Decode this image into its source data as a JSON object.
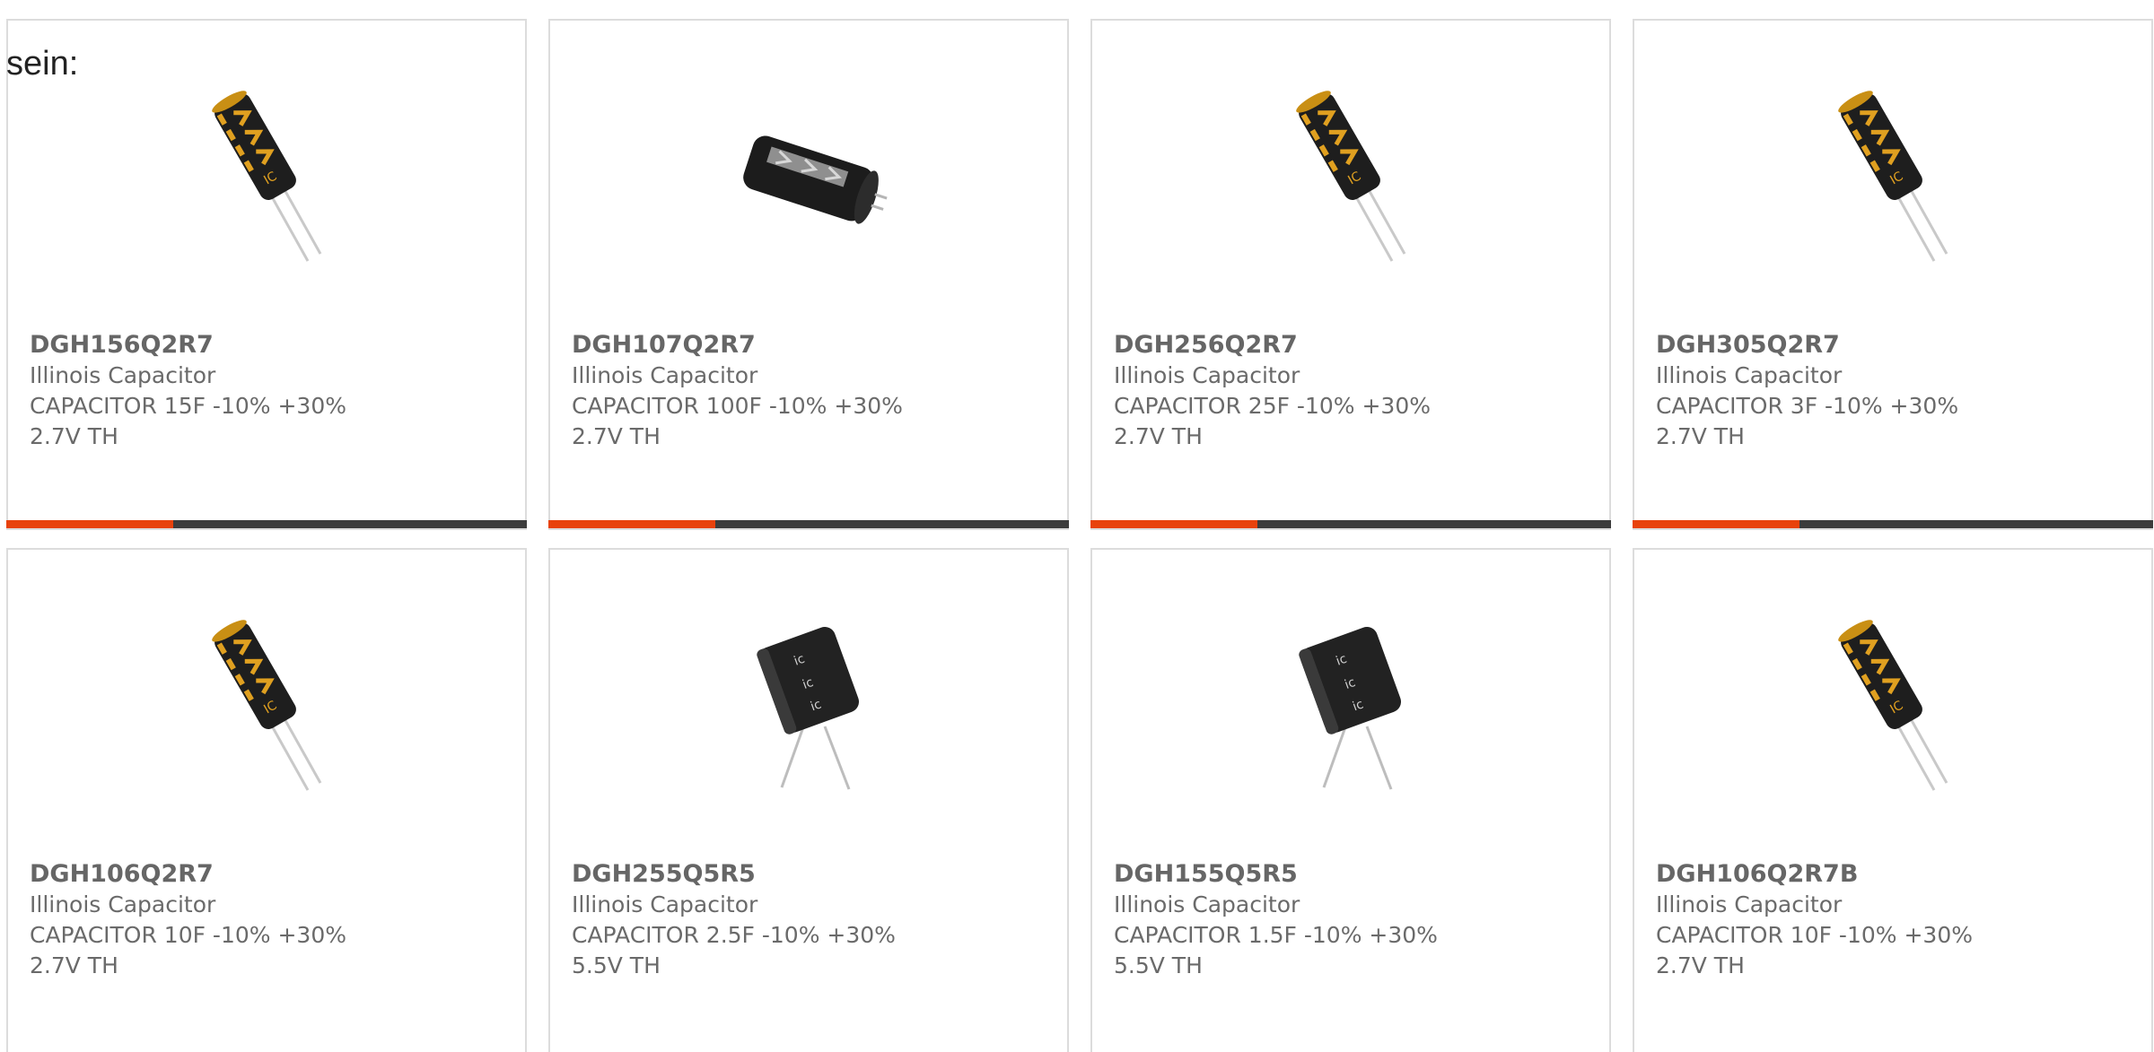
{
  "intro_text": "sein:",
  "products": [
    {
      "part": "DGH156Q2R7",
      "manufacturer": "Illinois Capacitor",
      "description": "CAPACITOR 15F -10% +30% 2.7V TH",
      "image": "capacitor-gold-icon",
      "progress_bar": true
    },
    {
      "part": "DGH107Q2R7",
      "manufacturer": "Illinois Capacitor",
      "description": "CAPACITOR 100F -10% +30% 2.7V TH",
      "image": "capacitor-large-icon",
      "progress_bar": true
    },
    {
      "part": "DGH256Q2R7",
      "manufacturer": "Illinois Capacitor",
      "description": "CAPACITOR 25F -10% +30% 2.7V TH",
      "image": "capacitor-gold-icon",
      "progress_bar": true
    },
    {
      "part": "DGH305Q2R7",
      "manufacturer": "Illinois Capacitor",
      "description": "CAPACITOR 3F -10% +30% 2.7V TH",
      "image": "capacitor-gold-icon",
      "progress_bar": true
    },
    {
      "part": "DGH106Q2R7",
      "manufacturer": "Illinois Capacitor",
      "description": "CAPACITOR 10F -10% +30% 2.7V TH",
      "image": "capacitor-gold-icon",
      "progress_bar": false
    },
    {
      "part": "DGH255Q5R5",
      "manufacturer": "Illinois Capacitor",
      "description": "CAPACITOR 2.5F -10% +30% 5.5V TH",
      "image": "capacitor-dual-icon",
      "progress_bar": false
    },
    {
      "part": "DGH155Q5R5",
      "manufacturer": "Illinois Capacitor",
      "description": "CAPACITOR 1.5F -10% +30% 5.5V TH",
      "image": "capacitor-dual-icon",
      "progress_bar": false
    },
    {
      "part": "DGH106Q2R7B",
      "manufacturer": "Illinois Capacitor",
      "description": "CAPACITOR 10F -10% +30% 2.7V TH",
      "image": "capacitor-gold-icon",
      "progress_bar": false
    }
  ],
  "colors": {
    "accent": "#e8420c",
    "bar_track": "#3c3c3c",
    "card_border": "#dcdcdc",
    "text": "#666666"
  }
}
